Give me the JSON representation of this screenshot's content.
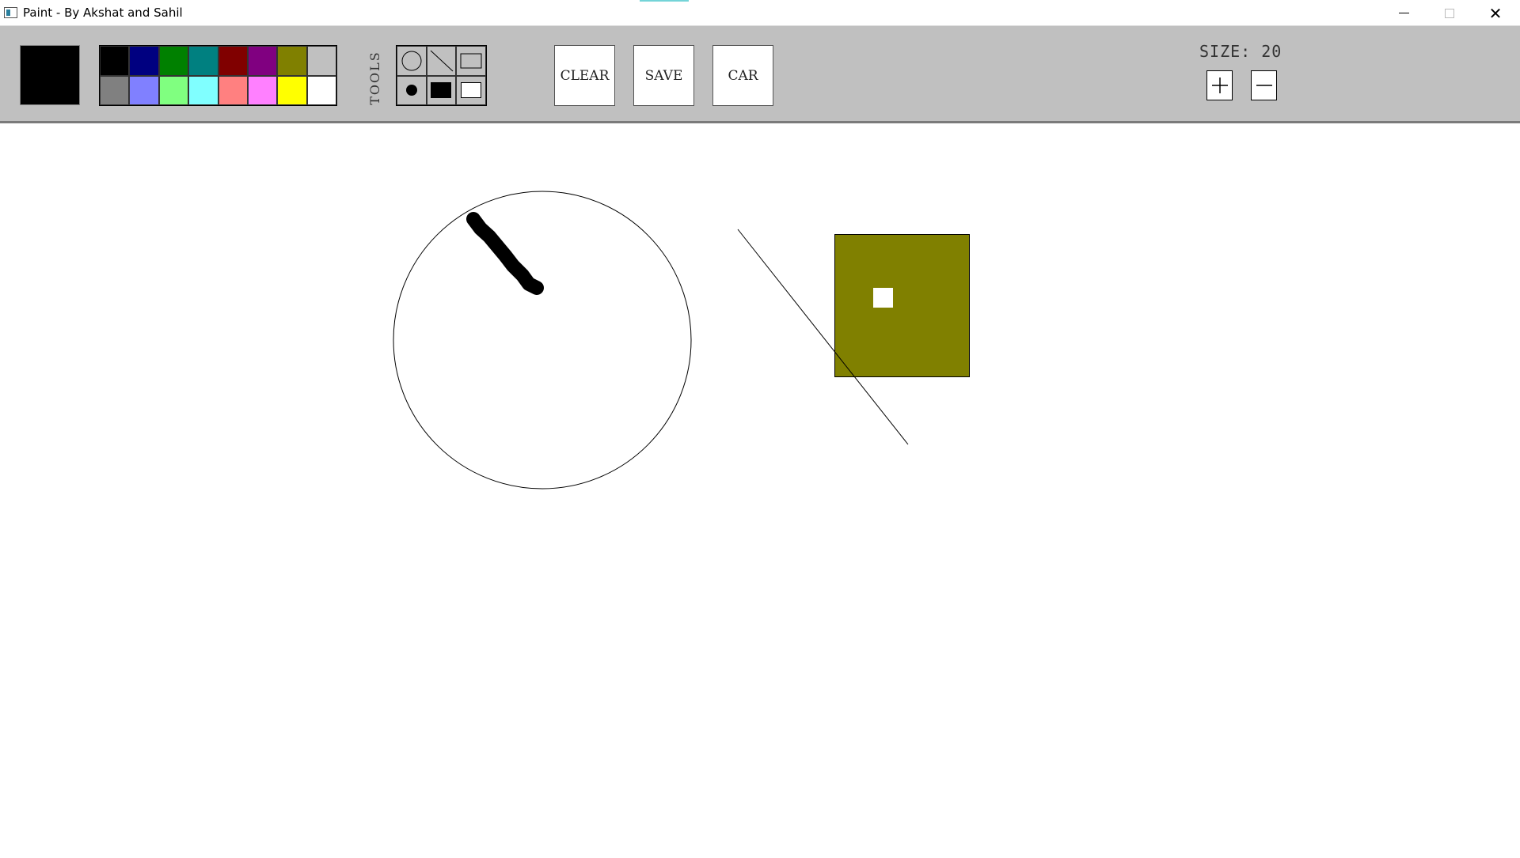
{
  "window": {
    "title": "Paint - By Akshat and Sahil",
    "controls": {
      "minimize": "minimize",
      "maximize": "maximize",
      "close": "✕"
    }
  },
  "toolbar": {
    "current_color": "#000000",
    "palette": [
      "#000000",
      "#000080",
      "#008000",
      "#008080",
      "#800000",
      "#800080",
      "#808000",
      "#c0c0c0",
      "#808080",
      "#8080ff",
      "#80ff80",
      "#80ffff",
      "#ff8080",
      "#ff80ff",
      "#ffff00",
      "#ffffff"
    ],
    "tools_label": "TOOLS",
    "tools": [
      {
        "icon": "circle-outline-icon"
      },
      {
        "icon": "line-icon"
      },
      {
        "icon": "rectangle-outline-icon"
      },
      {
        "icon": "brush-dot-icon"
      },
      {
        "icon": "filled-rectangle-icon"
      },
      {
        "icon": "white-rectangle-icon"
      }
    ],
    "clear_label": "CLEAR",
    "save_label": "SAVE",
    "car_label": "CAR",
    "size_label": "SIZE: 20",
    "increase_icon": "plus-icon",
    "decrease_icon": "minus-icon"
  },
  "canvas": {
    "shapes": [
      {
        "kind": "circle-outline",
        "color": "#000000"
      },
      {
        "kind": "brush-stroke",
        "color": "#000000"
      },
      {
        "kind": "line",
        "color": "#000000"
      },
      {
        "kind": "filled-rectangle",
        "color": "#808000",
        "outline": "#000000"
      },
      {
        "kind": "filled-rectangle",
        "color": "#ffffff"
      }
    ]
  }
}
